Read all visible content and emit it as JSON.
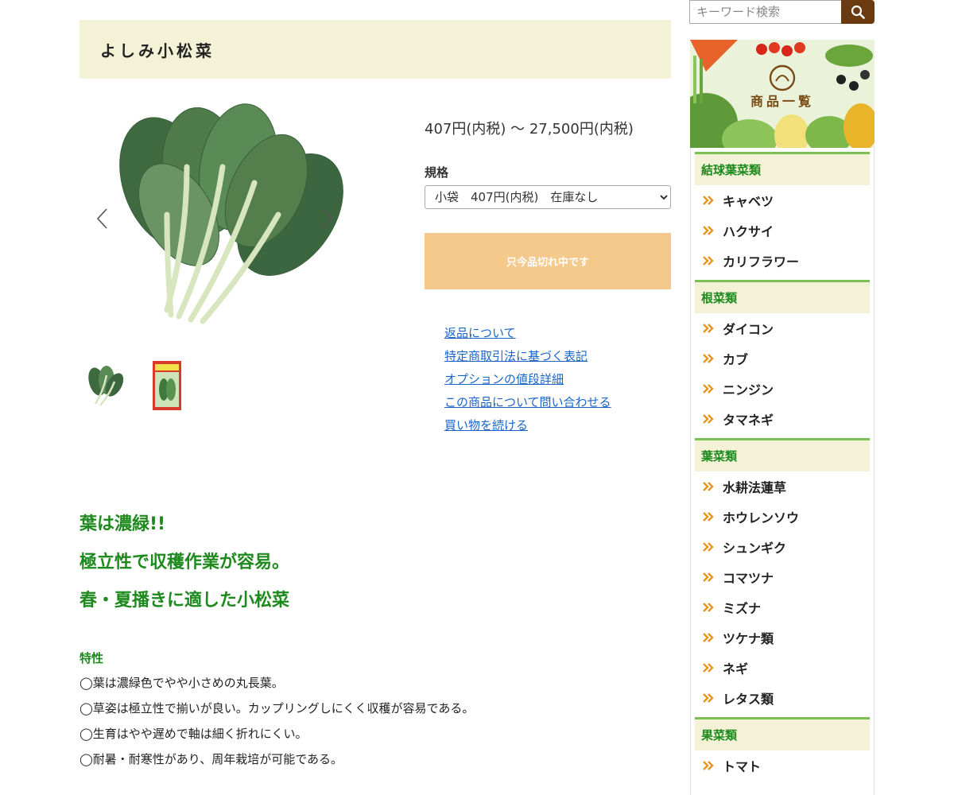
{
  "product": {
    "title": "よしみ小松菜",
    "price_range": "407円(内税) 〜 27,500円(内税)",
    "spec_label": "規格",
    "spec_selected": "小袋　407円(内税)　在庫なし",
    "soldout_label": "只今品切れ中です"
  },
  "links": [
    "返品について",
    "特定商取引法に基づく表記",
    "オプションの値段詳細",
    "この商品について問い合わせる",
    "買い物を続ける"
  ],
  "description": {
    "catch": [
      "葉は濃緑!!",
      "極立性で収穫作業が容易。",
      "春・夏播きに適した小松菜"
    ],
    "features_title": "特性",
    "features": [
      "◯葉は濃緑色でやや小さめの丸長葉。",
      "◯草姿は極立性で揃いが良い。カップリングしにくく収穫が容易である。",
      "◯生育はやや遅めで軸は細く折れにくい。",
      "◯耐暑・耐寒性があり、周年栽培が可能である。"
    ]
  },
  "search": {
    "placeholder": "キーワード検索"
  },
  "banner": {
    "label": "商品一覧"
  },
  "categories": [
    {
      "name": "結球葉菜類",
      "items": [
        "キャベツ",
        "ハクサイ",
        "カリフラワー"
      ]
    },
    {
      "name": "根菜類",
      "items": [
        "ダイコン",
        "カブ",
        "ニンジン",
        "タマネギ"
      ]
    },
    {
      "name": "葉菜類",
      "items": [
        "水耕法蓮草",
        "ホウレンソウ",
        "シュンギク",
        "コマツナ",
        "ミズナ",
        "ツケナ類",
        "ネギ",
        "レタス類"
      ]
    },
    {
      "name": "果菜類",
      "items": [
        "トマト"
      ]
    }
  ],
  "colors": {
    "accent_green": "#1e8a1e",
    "title_bg": "#f3f2d6",
    "soldout_bg": "#f5c98c",
    "search_btn": "#6b3a10",
    "link_blue": "#1a64c8",
    "chevron_orange": "#e8951e"
  }
}
